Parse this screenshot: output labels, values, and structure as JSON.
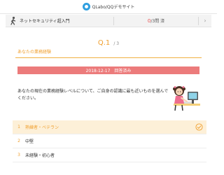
{
  "header": {
    "title": "QLabo/QQデモサイト",
    "logo_icon": "qlabo-logo-icon"
  },
  "progress": {
    "course_icon": "walk-icon",
    "course_name": "ネットセキュリティ超入門",
    "answered": "0",
    "total_label": "/3問 済",
    "next_icon": "chevron-right-icon"
  },
  "question": {
    "number_label": "Q.1",
    "total_label": "/ 3",
    "category": "あなたの業務経験",
    "status_banner": "2018-12-17　回答済み",
    "text": "あなたの現在の業務経験レベルについて、ご自身の認識に最も近いものを選んでください。",
    "illustration": "girl-at-computer-illustration"
  },
  "answers": [
    {
      "number": "1",
      "label": "熟練者・ベテラン",
      "selected": true
    },
    {
      "number": "2",
      "label": "中堅",
      "selected": false
    },
    {
      "number": "3",
      "label": "未経験・初心者",
      "selected": false
    }
  ],
  "colors": {
    "accent": "#f0a030",
    "banner": "#ec7b7b",
    "count": "#e74c4c",
    "brand": "#2f9fe0"
  }
}
